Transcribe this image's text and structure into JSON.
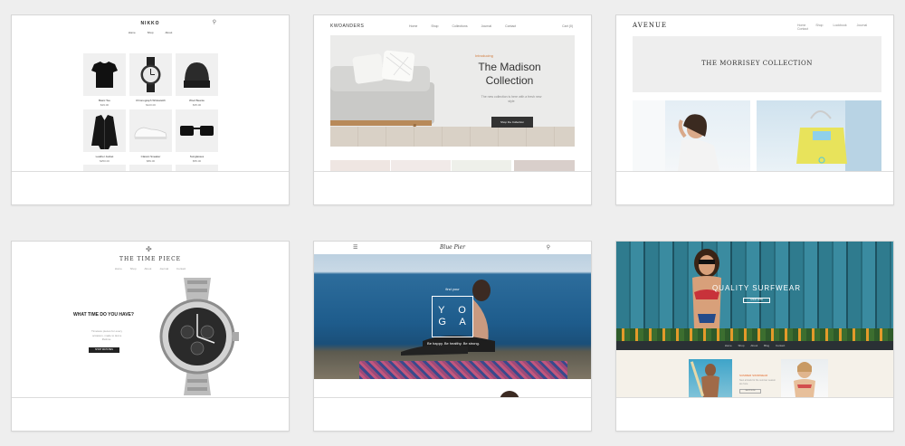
{
  "cards": [
    {
      "logo": "NIKKO",
      "nav": [
        "Home",
        "Shop",
        "About"
      ],
      "products": [
        {
          "name": "Basic Tee",
          "price": "$29.00"
        },
        {
          "name": "Chronograph Wristwatch",
          "price": "$120.00"
        },
        {
          "name": "Wool Beanie",
          "price": "$35.00"
        },
        {
          "name": "Leather Jacket",
          "price": "$250.00"
        },
        {
          "name": "Classic Sneaker",
          "price": "$89.00"
        },
        {
          "name": "Sunglasses",
          "price": "$55.00"
        }
      ]
    },
    {
      "logo": "KWOANDERS",
      "nav": [
        "Home",
        "Shop",
        "Collections",
        "Journal",
        "Contact"
      ],
      "cart": "Cart (0)",
      "intro": "Introducing",
      "title_line1": "The Madison",
      "title_line2": "Collection",
      "subtitle": "The new collection is here with a fresh new style",
      "cta": "Shop the Collection"
    },
    {
      "logo": "AVENUE",
      "nav": [
        "Home",
        "Shop",
        "Lookbook",
        "Journal",
        "Contact"
      ],
      "banner": "THE MORRISEY COLLECTION"
    },
    {
      "logo": "THE TIME PIECE",
      "nav": [
        "Home",
        "Shop",
        "About",
        "Journal",
        "Contact"
      ],
      "question": "WHAT TIME DO YOU HAVE?",
      "question_sub": "Timeless pieces for every occasion, made to last a lifetime.",
      "cta": "SHOP WATCHES"
    },
    {
      "logo": "Blue Pier",
      "pre": "find your",
      "yoga_line1": "Y O",
      "yoga_line2": "G A",
      "tagline": "Be happy. Be healthy. Be strong."
    },
    {
      "quality": "QUALITY SURFWEAR",
      "quality_cta": "SHOP NOW",
      "nav": [
        "Home",
        "Shop",
        "About",
        "Blog",
        "Contact"
      ],
      "section_title": "SUMMER SWIMWEAR",
      "section_desc": "New arrivals for the summer season are here.",
      "section_cta": "SHOP NOW"
    }
  ]
}
